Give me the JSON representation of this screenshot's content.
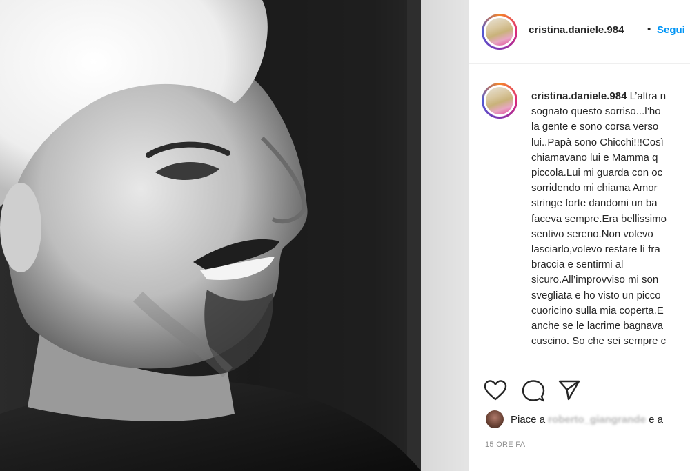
{
  "post": {
    "username": "cristina.daniele.984",
    "follow_label": "Seguì",
    "separator": "•",
    "caption_lines": [
      "L’altra n",
      "sognato questo sorriso...l’ho",
      "la gente e sono corsa verso",
      "lui..Papà sono Chicchi!!!Così",
      "chiamavano lui e Mamma q",
      "piccola.Lui mi guarda con oc",
      "sorridendo mi chiama Amor",
      "stringe forte dandomi un ba",
      "faceva sempre.Era bellissimo",
      "sentivo sereno.Non volevo",
      "lasciarlo,volevo restare lì fra",
      "braccia e sentirmi al",
      "sicuro.All’improvviso mi son",
      "svegliata e ho visto un picco",
      "cuoricino sulla mia coperta.E",
      "anche se le lacrime bagnava",
      "cuscino. So che sei sempre c"
    ],
    "likes_prefix": "Piace a",
    "likes_user": "roberto_giangrande",
    "likes_suffix": "e a",
    "timestamp": "15 ORE FA"
  },
  "icons": {
    "like": "heart-icon",
    "comment": "comment-icon",
    "share": "share-icon"
  },
  "colors": {
    "accent": "#0095f6",
    "text": "#262626",
    "muted": "#8e8e8e",
    "border": "#efefef"
  }
}
